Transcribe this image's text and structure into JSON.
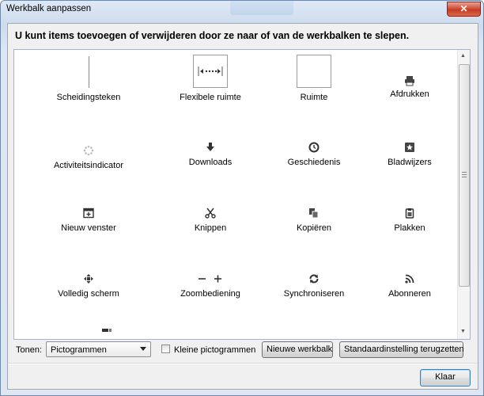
{
  "window": {
    "title": "Werkbalk aanpassen",
    "close_label": "✕"
  },
  "heading": "U kunt items toevoegen of verwijderen door ze naar of van de werkbalken te slepen.",
  "items": [
    {
      "label": "Scheidingsteken",
      "icon": "separator-icon"
    },
    {
      "label": "Flexibele ruimte",
      "icon": "flexible-space-icon"
    },
    {
      "label": "Ruimte",
      "icon": "space-icon"
    },
    {
      "label": "Afdrukken",
      "icon": "printer-icon"
    },
    {
      "label": "Activiteitsindicator",
      "icon": "throbber-icon"
    },
    {
      "label": "Downloads",
      "icon": "download-arrow-icon"
    },
    {
      "label": "Geschiedenis",
      "icon": "clock-icon"
    },
    {
      "label": "Bladwijzers",
      "icon": "bookmark-star-icon"
    },
    {
      "label": "Nieuw venster",
      "icon": "new-window-icon"
    },
    {
      "label": "Knippen",
      "icon": "scissors-icon"
    },
    {
      "label": "Kopiëren",
      "icon": "copy-icon"
    },
    {
      "label": "Plakken",
      "icon": "clipboard-icon"
    },
    {
      "label": "Volledig scherm",
      "icon": "fullscreen-icon"
    },
    {
      "label": "Zoombediening",
      "icon": "zoom-controls-icon"
    },
    {
      "label": "Synchroniseren",
      "icon": "sync-icon"
    },
    {
      "label": "Abonneren",
      "icon": "rss-feed-icon"
    }
  ],
  "footer": {
    "tonen_label": "Tonen:",
    "tonen_value": "Pictogrammen",
    "small_icons_label": "Kleine pictogrammen",
    "small_icons_checked": false,
    "new_toolbar_label": "Nieuwe werkbalk",
    "restore_default_label": "Standaardinstelling terugzetten",
    "ok_label": "Klaar"
  },
  "colors": {
    "window_border": "#6f8aa8",
    "close_button": "#c43b22",
    "default_button_border": "#3c7fb1"
  }
}
